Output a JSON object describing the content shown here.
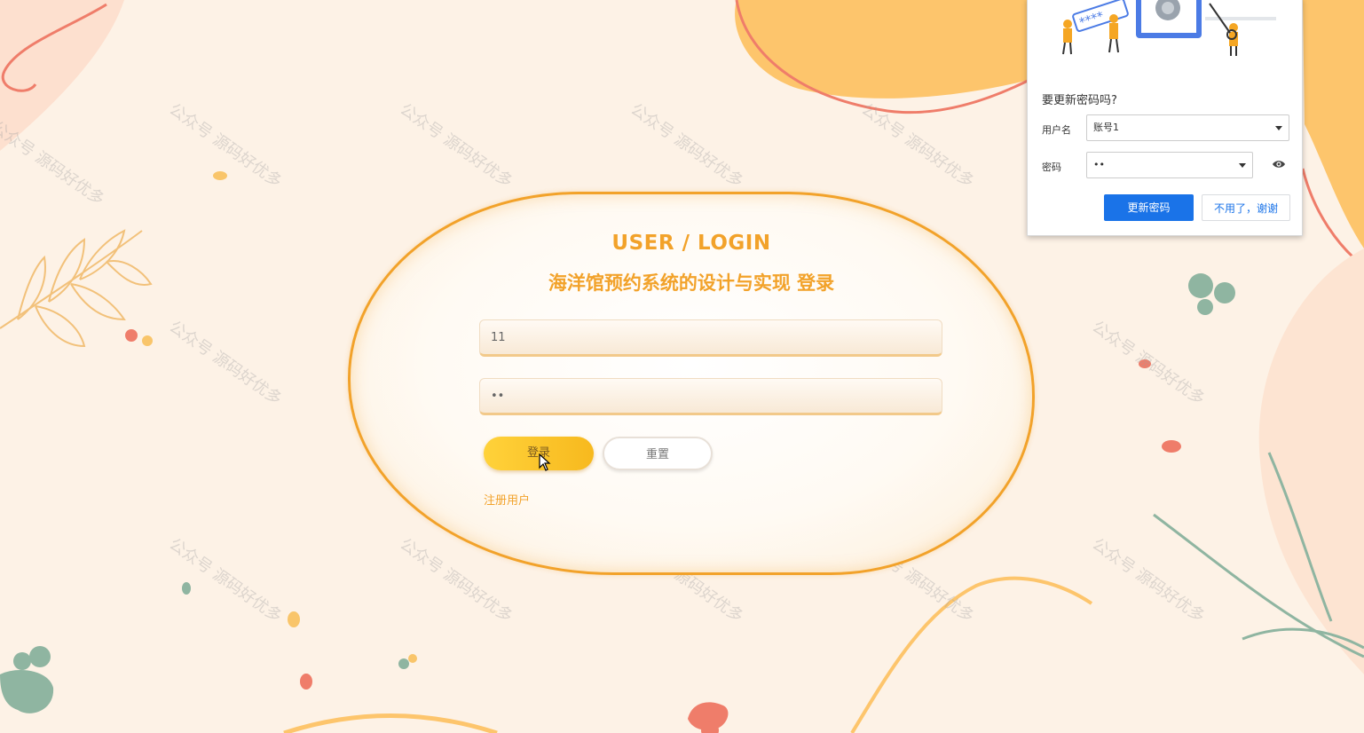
{
  "login": {
    "title_en": "USER / LOGIN",
    "title_cn": "海洋馆预约系统的设计与实现 登录",
    "username_value": "11",
    "password_value": "••",
    "login_button": "登录",
    "reset_button": "重置",
    "register_link": "注册用户"
  },
  "watermark": "公众号 源码好优多",
  "password_popup": {
    "title": "要更新密码吗?",
    "username_label": "用户名",
    "username_value": "账号1",
    "password_label": "密码",
    "password_value": "••",
    "update_button": "更新密码",
    "no_thanks_button": "不用了，谢谢",
    "illustration_stars": "****"
  },
  "colors": {
    "accent": "#f2a22a",
    "login_button": "#ffd23a",
    "popup_primary": "#1a73e8",
    "background": "#fdf2e6"
  }
}
